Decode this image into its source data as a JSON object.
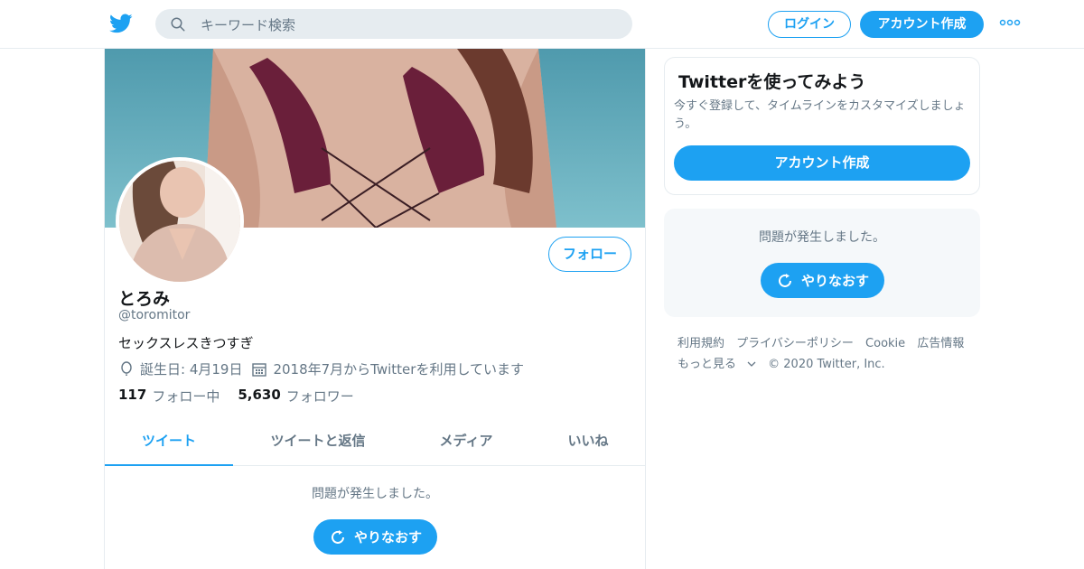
{
  "topbar": {
    "logo_icon": "twitter-bird-icon",
    "search_placeholder": "キーワード検索",
    "login_label": "ログイン",
    "signup_label": "アカウント作成",
    "more_icon": "more-dots-icon"
  },
  "profile": {
    "display_name": "とろみ",
    "handle": "@toromitor",
    "bio": "セックスレスきつすぎ",
    "birthday": "誕生日: 4月19日",
    "joined": "2018年7月からTwitterを利用しています",
    "following_count": "117",
    "following_label": "フォロー中",
    "followers_count": "5,630",
    "followers_label": "フォロワー",
    "follow_button": "フォロー"
  },
  "tabs": [
    {
      "label": "ツイート",
      "active": true
    },
    {
      "label": "ツイートと返信",
      "active": false
    },
    {
      "label": "メディア",
      "active": false
    },
    {
      "label": "いいね",
      "active": false
    }
  ],
  "timeline": {
    "error_text": "問題が発生しました。",
    "retry_label": "やりなおす"
  },
  "sidebar": {
    "card_title": "Twitterを使ってみよう",
    "card_subtitle": "今すぐ登録して、タイムラインをカスタマイズしましょう。",
    "card_button": "アカウント作成",
    "error_text": "問題が発生しました。",
    "retry_label": "やりなおす",
    "footer_links": [
      "利用規約",
      "プライバシーポリシー",
      "Cookie",
      "広告情報",
      "もっと見る"
    ],
    "copyright": "© 2020 Twitter, Inc."
  },
  "colors": {
    "accent": "#1da1f2",
    "muted_text": "#657786",
    "border": "#e6ecf0"
  }
}
